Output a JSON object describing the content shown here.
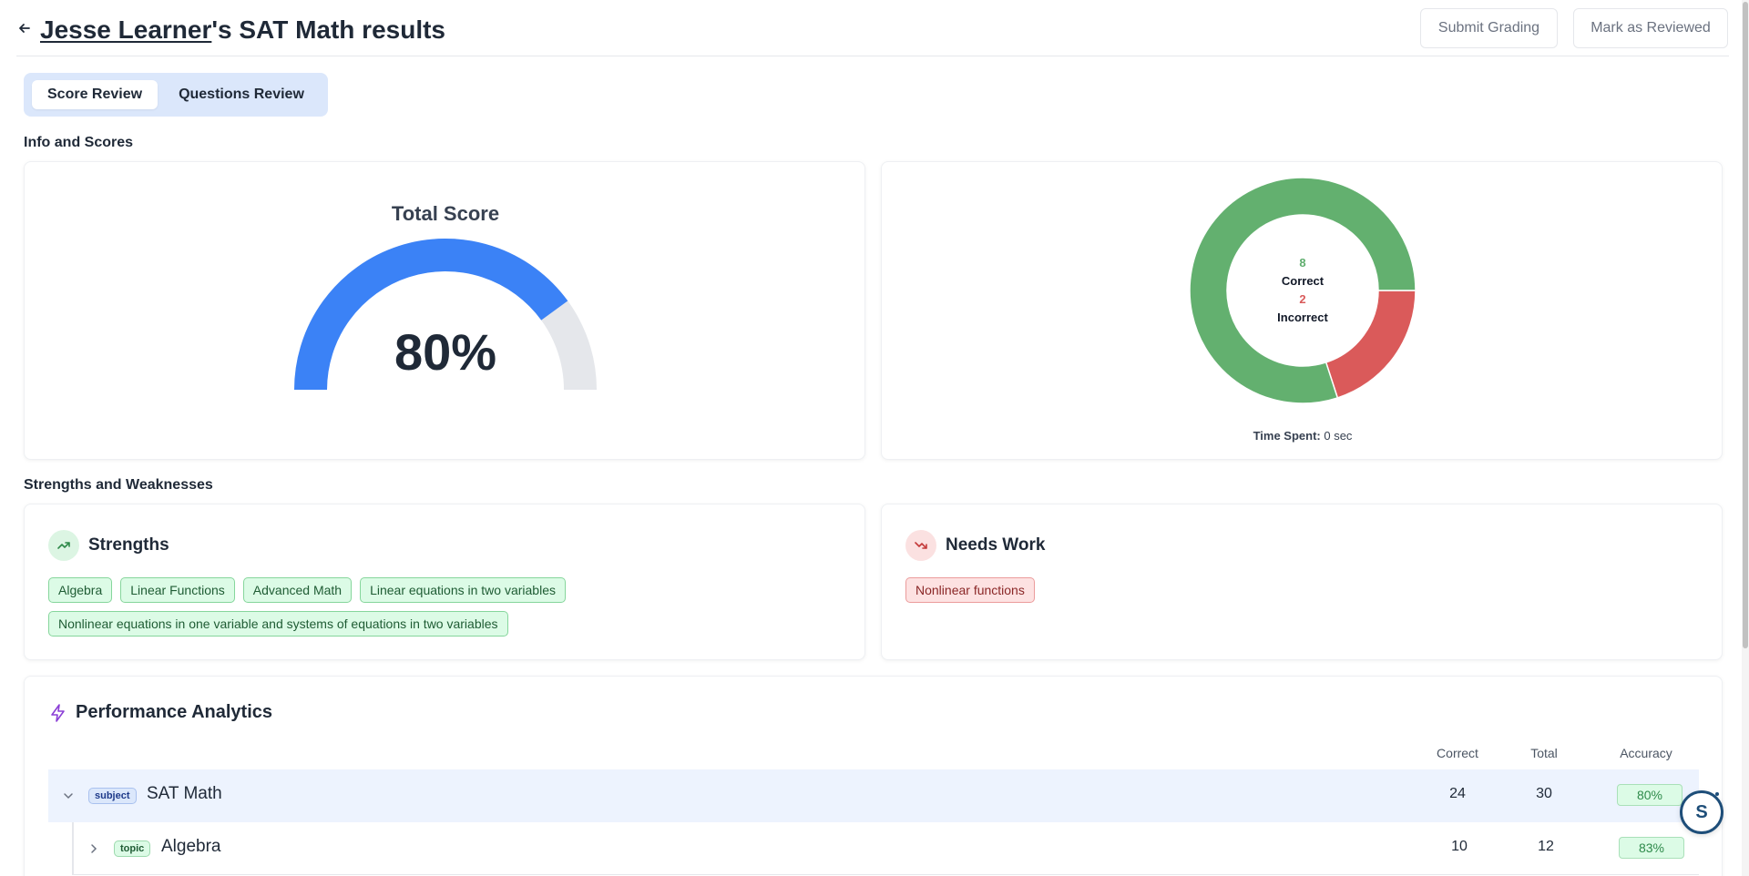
{
  "header": {
    "student_name": "Jesse Learner",
    "title_suffix": "'s SAT Math results",
    "submit_label": "Submit Grading",
    "review_label": "Mark as Reviewed"
  },
  "tabs": [
    {
      "label": "Score Review",
      "active": true
    },
    {
      "label": "Questions Review",
      "active": false
    }
  ],
  "sections": {
    "info_scores": "Info and Scores",
    "strengths_weaknesses": "Strengths and Weaknesses"
  },
  "score": {
    "title": "Total Score",
    "value_label": "80%",
    "fraction": 0.8,
    "fill_color": "#3b82f6",
    "track_color": "#e5e7eb"
  },
  "chart_data": {
    "type": "pie",
    "categories": [
      "Correct",
      "Incorrect"
    ],
    "values": [
      8,
      2
    ],
    "colors": [
      "#63b06f",
      "#da5a5a"
    ],
    "labels": {
      "correct_count": "8",
      "correct_label": "Correct",
      "incorrect_count": "2",
      "incorrect_label": "Incorrect"
    }
  },
  "time_spent": {
    "label": "Time Spent:",
    "value": "0 sec"
  },
  "strengths": {
    "title": "Strengths",
    "items": [
      "Algebra",
      "Linear Functions",
      "Advanced Math",
      "Linear equations in two variables",
      "Nonlinear equations in one variable and systems of equations in two variables"
    ]
  },
  "needs_work": {
    "title": "Needs Work",
    "items": [
      "Nonlinear functions"
    ]
  },
  "performance": {
    "title": "Performance Analytics",
    "columns": {
      "correct": "Correct",
      "total": "Total",
      "accuracy": "Accuracy"
    },
    "rows": [
      {
        "tag": "subject",
        "name": "SAT Math",
        "correct": "24",
        "total": "30",
        "accuracy": "80%"
      },
      {
        "tag": "topic",
        "name": "Algebra",
        "correct": "10",
        "total": "12",
        "accuracy": "83%"
      }
    ]
  },
  "fab": {
    "label": "S"
  },
  "icons": {
    "back": "arrow-left-icon",
    "strengths": "trending-up-icon",
    "needs_work": "trending-down-icon",
    "performance": "lightning-icon"
  }
}
